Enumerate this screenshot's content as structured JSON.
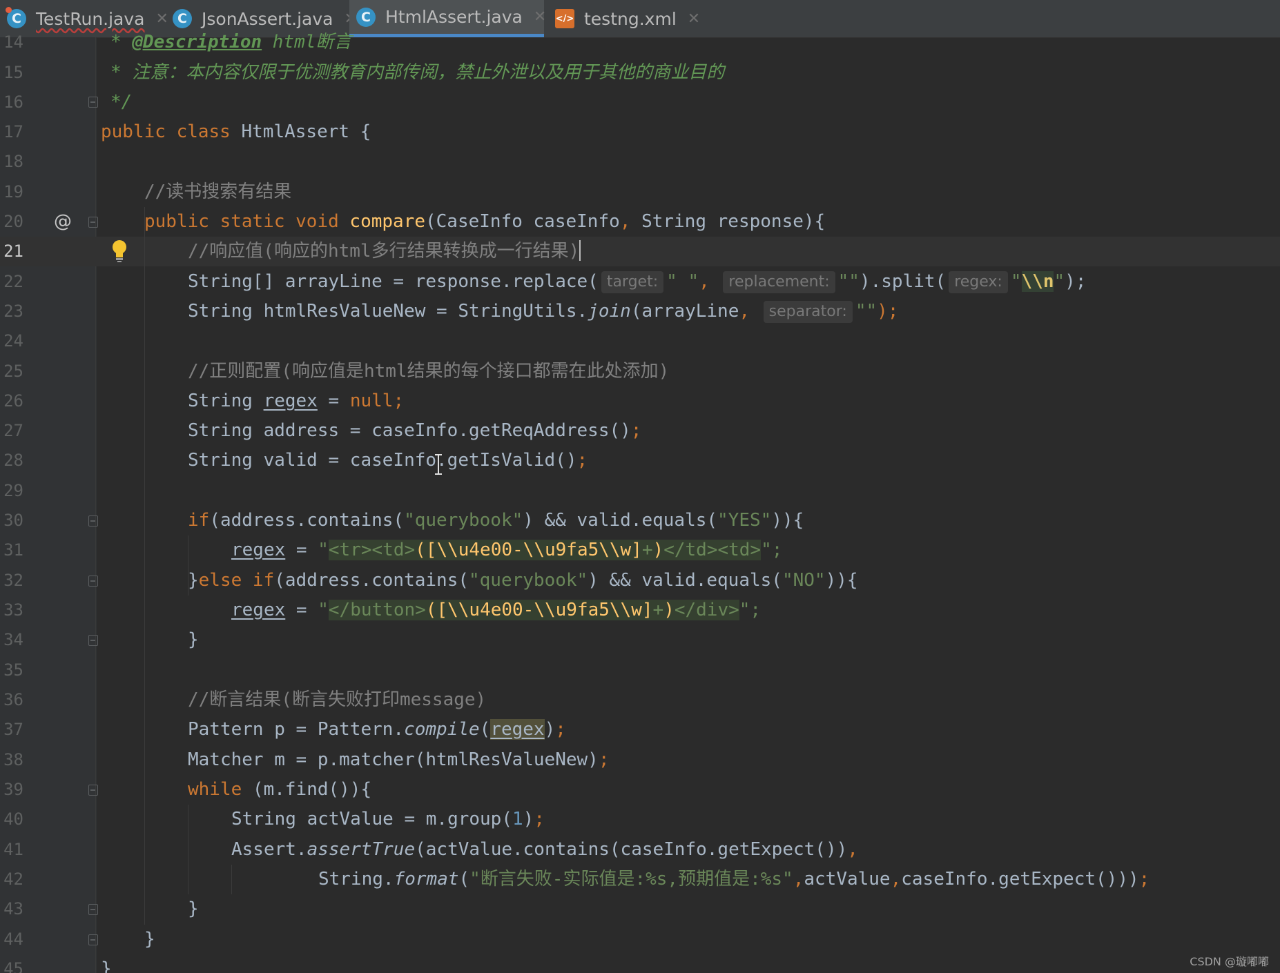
{
  "tabs": [
    {
      "label": "TestRun.java",
      "icon": "java-class-icon",
      "active": false
    },
    {
      "label": "JsonAssert.java",
      "icon": "java-class-icon",
      "active": false
    },
    {
      "label": "HtmlAssert.java",
      "icon": "java-class-icon",
      "active": true
    },
    {
      "label": "testng.xml",
      "icon": "xml-file-icon",
      "active": false
    }
  ],
  "editor": {
    "current_line": 21,
    "line_numbers": [
      "14",
      "15",
      "16",
      "17",
      "18",
      "19",
      "20",
      "21",
      "22",
      "23",
      "24",
      "25",
      "26",
      "27",
      "28",
      "29",
      "30",
      "31",
      "32",
      "33",
      "34",
      "35",
      "36",
      "37",
      "38",
      "39",
      "40",
      "41",
      "42",
      "43",
      "44",
      "45"
    ],
    "lines": {
      "l14": {
        "t0": "* ",
        "t1": "@Description",
        "t2": " html断言"
      },
      "l15": {
        "t0": "* 注意：本内容仅限于优测教育内部传阅，禁止外泄以及用于其他的商业目的"
      },
      "l16": {
        "t0": "*/"
      },
      "l17": {
        "t0": "public class ",
        "t1": "HtmlAssert {"
      },
      "l19": {
        "t0": "//读书搜索有结果"
      },
      "l20": {
        "t0": "public static void ",
        "t1": "compare",
        "t2": "(CaseInfo caseInfo",
        "t3": ", ",
        "t4": "String response){"
      },
      "l21": {
        "t0": "//响应值(响应的html多行结果转换成一行结果)"
      },
      "l22": {
        "t0": "String[] arrayLine = response.replace(",
        "h1": "target:",
        "t1": "\" \"",
        "t2": ", ",
        "h2": "replacement:",
        "t3": "\"\"",
        "t4": ").split(",
        "h3": "regex:",
        "t5": "\"",
        "t6": "\\\\n",
        "t7": "\"",
        "t8": ");"
      },
      "l23": {
        "t0": "String htmlResValueNew = StringUtils.",
        "t1": "join",
        "t2": "(arrayLine",
        "t3": ", ",
        "h1": "separator:",
        "t4": "\"\"",
        "t5": ");"
      },
      "l25": {
        "t0": "//正则配置(响应值是html结果的每个接口都需在此处添加)"
      },
      "l26": {
        "t0": "String ",
        "t1": "regex",
        "t2": " = ",
        "t3": "null;"
      },
      "l27": {
        "t0": "String address = caseInfo.getReqAddress()",
        "t1": ";"
      },
      "l28": {
        "t0": "String valid = caseInfo.getIsValid()",
        "t1": ";"
      },
      "l30": {
        "t0": "if",
        "t1": "(address.contains(",
        "t2": "\"querybook\"",
        "t3": ") && valid.equals(",
        "t4": "\"YES\"",
        "t5": ")){"
      },
      "l31": {
        "t0": "regex",
        "t1": " = ",
        "t2": "\"",
        "t3": "<tr><td>",
        "t4": "([\\\\u4e00-\\\\u9fa5\\\\w]",
        "t5": "+",
        "t6": ")",
        "t7": "</td><td>",
        "t8": "\";"
      },
      "l32": {
        "t0": "}",
        "t1": "else if",
        "t2": "(address.contains(",
        "t3": "\"querybook\"",
        "t4": ") && valid.equals(",
        "t5": "\"NO\"",
        "t6": ")){"
      },
      "l33": {
        "t0": "regex",
        "t1": " = ",
        "t2": "\"",
        "t3": "</button>",
        "t4": "([\\\\u4e00-\\\\u9fa5\\\\w]",
        "t5": "+",
        "t6": ")",
        "t7": "</div>",
        "t8": "\";"
      },
      "l34": {
        "t0": "}"
      },
      "l36": {
        "t0": "//断言结果(断言失败打印message)"
      },
      "l37": {
        "t0": "Pattern p = Pattern.",
        "t1": "compile",
        "t2": "(",
        "t3": "regex",
        "t4": ")",
        "t5": ";"
      },
      "l38": {
        "t0": "Matcher m = p.matcher(htmlResValueNew)",
        "t1": ";"
      },
      "l39": {
        "t0": "while ",
        "t1": "(m.find()){"
      },
      "l40": {
        "t0": "String actValue = m.group(",
        "t1": "1",
        "t2": ")",
        "t3": ";"
      },
      "l41": {
        "t0": "Assert.",
        "t1": "assertTrue",
        "t2": "(actValue.contains(caseInfo.getExpect())",
        "t3": ","
      },
      "l42": {
        "t0": "String.",
        "t1": "format",
        "t2": "(",
        "t3": "\"断言失败-实际值是:%s,预期值是:%s\"",
        "t4": ",",
        "t5": "actValue",
        "t6": ",",
        "t7": "caseInfo.getExpect()))",
        "t8": ";"
      },
      "l43": {
        "t0": "}"
      },
      "l44": {
        "t0": "}"
      },
      "l45": {
        "t0": "}"
      }
    }
  },
  "gutter": {
    "override_marker": "@",
    "override_icon": "override-method-icon",
    "intention_icon": "lightbulb-icon"
  },
  "colors": {
    "background": "#2b2b2b",
    "keyword": "#cc7832",
    "string": "#6a8759",
    "comment": "#808080",
    "method": "#ffc66d",
    "text": "#a9b7c6"
  },
  "watermark": "CSDN @璇嘟嘟"
}
